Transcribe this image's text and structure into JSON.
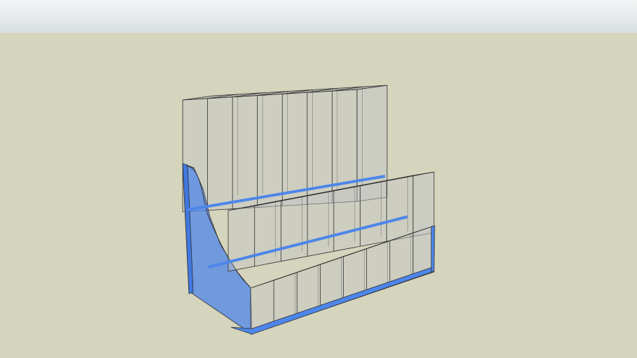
{
  "scene": {
    "colors": {
      "sky": "#e6ebeb",
      "ground": "#d5d4bc",
      "acrylic_blue": "#4d86ea",
      "glass": "#c4c6c6",
      "edge": "#2e2e2e"
    },
    "tiers": [
      {
        "name": "top",
        "cells": 7
      },
      {
        "name": "middle",
        "cells": 7
      },
      {
        "name": "bottom",
        "cells": 7
      }
    ]
  }
}
